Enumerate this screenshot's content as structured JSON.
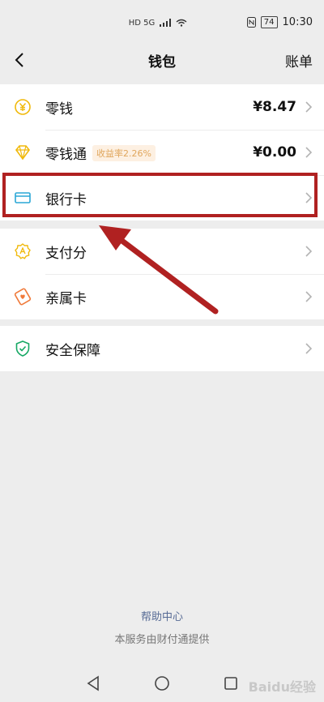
{
  "status_bar": {
    "left_indicators": "HD 5G",
    "red_badge": "",
    "battery": "74",
    "time": "10:30"
  },
  "nav": {
    "title": "钱包",
    "right_action": "账单"
  },
  "sections": [
    {
      "items": [
        {
          "label": "零钱",
          "value": "¥8.47",
          "icon": "coin-icon",
          "accent": "#f0b90b"
        },
        {
          "label": "零钱通",
          "value": "¥0.00",
          "tag": "收益率2.26%",
          "icon": "diamond-icon",
          "accent": "#f0b90b"
        },
        {
          "label": "银行卡",
          "icon": "bank-card-icon",
          "accent": "#2aa7d6"
        }
      ]
    },
    {
      "items": [
        {
          "label": "支付分",
          "icon": "score-badge-icon",
          "accent": "#f0b90b"
        },
        {
          "label": "亲属卡",
          "icon": "family-card-icon",
          "accent": "#f07a3a"
        }
      ]
    },
    {
      "items": [
        {
          "label": "安全保障",
          "icon": "shield-icon",
          "accent": "#16a864"
        }
      ]
    }
  ],
  "footer": {
    "help_link": "帮助中心",
    "provider_note": "本服务由财付通提供"
  },
  "watermark": "Baidu经验",
  "colors": {
    "highlight": "#b02121",
    "link": "#576b95"
  }
}
